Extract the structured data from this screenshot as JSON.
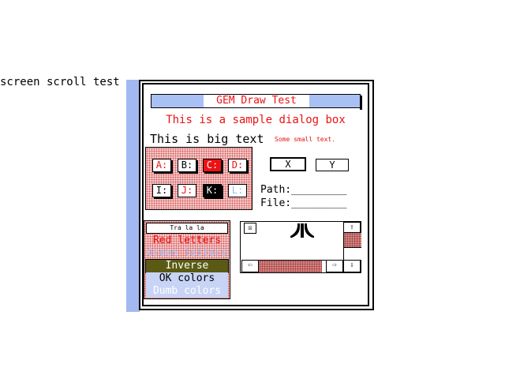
{
  "caption": "screen scroll test",
  "dialog": {
    "title": "GEM Draw Test",
    "subtitle": "This is a sample dialog box",
    "big_text": "This is big text",
    "small_text": "Some small text.",
    "drives_row1": [
      "A:",
      "B:",
      "C:",
      "D:"
    ],
    "drives_row2": [
      "I:",
      "J:",
      "K:",
      "L:"
    ],
    "button_x": "X",
    "button_y": "Y",
    "path_label": "Path:_________",
    "file_label": "File:_________",
    "list": {
      "header": "Tra la la",
      "items": [
        "Red letters",
        "Green letters",
        "Inverse",
        "OK colors",
        "Dumb colors"
      ]
    },
    "slider": {
      "close": "☒",
      "up": "⇧",
      "down": "⇩",
      "left": "⇦",
      "right": "⇨"
    }
  },
  "colors": {
    "accent_red": "#ee1111",
    "accent_blue": "#a3b8f0",
    "title_blue": "#a9c0f4",
    "dither_pink": "#f3caca"
  }
}
